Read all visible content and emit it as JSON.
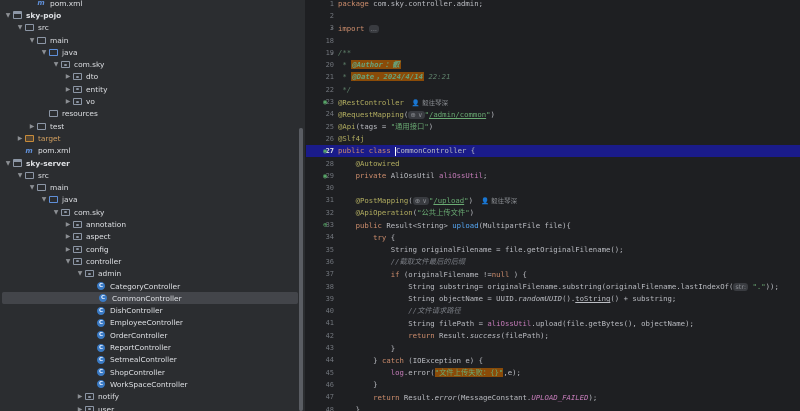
{
  "project_tree": {
    "items": [
      {
        "label": "pom.xml",
        "indent": 2,
        "chevron": "",
        "icon": "maven-icon"
      },
      {
        "label": "sky-pojo",
        "indent": 0,
        "chevron": "v",
        "icon": "module-folder-icon",
        "bold": true
      },
      {
        "label": "src",
        "indent": 1,
        "chevron": "v",
        "icon": "folder-icon"
      },
      {
        "label": "main",
        "indent": 2,
        "chevron": "v",
        "icon": "folder-icon"
      },
      {
        "label": "java",
        "indent": 3,
        "chevron": "v",
        "icon": "source-folder-icon"
      },
      {
        "label": "com.sky",
        "indent": 4,
        "chevron": "v",
        "icon": "package-icon"
      },
      {
        "label": "dto",
        "indent": 5,
        "chevron": ">",
        "icon": "package-icon"
      },
      {
        "label": "entity",
        "indent": 5,
        "chevron": ">",
        "icon": "package-icon"
      },
      {
        "label": "vo",
        "indent": 5,
        "chevron": ">",
        "icon": "package-icon"
      },
      {
        "label": "resources",
        "indent": 3,
        "chevron": "",
        "icon": "resources-folder-icon"
      },
      {
        "label": "test",
        "indent": 2,
        "chevron": ">",
        "icon": "folder-icon"
      },
      {
        "label": "target",
        "indent": 1,
        "chevron": ">",
        "icon": "target-folder-icon",
        "target": true
      },
      {
        "label": "pom.xml",
        "indent": 1,
        "chevron": "",
        "icon": "maven-icon"
      },
      {
        "label": "sky-server",
        "indent": 0,
        "chevron": "v",
        "icon": "module-folder-icon",
        "bold": true
      },
      {
        "label": "src",
        "indent": 1,
        "chevron": "v",
        "icon": "folder-icon"
      },
      {
        "label": "main",
        "indent": 2,
        "chevron": "v",
        "icon": "folder-icon"
      },
      {
        "label": "java",
        "indent": 3,
        "chevron": "v",
        "icon": "source-folder-icon"
      },
      {
        "label": "com.sky",
        "indent": 4,
        "chevron": "v",
        "icon": "package-icon"
      },
      {
        "label": "annotation",
        "indent": 5,
        "chevron": ">",
        "icon": "package-icon"
      },
      {
        "label": "aspect",
        "indent": 5,
        "chevron": ">",
        "icon": "package-icon"
      },
      {
        "label": "config",
        "indent": 5,
        "chevron": ">",
        "icon": "package-icon"
      },
      {
        "label": "controller",
        "indent": 5,
        "chevron": "v",
        "icon": "package-icon"
      },
      {
        "label": "admin",
        "indent": 6,
        "chevron": "v",
        "icon": "package-icon"
      },
      {
        "label": "CategoryController",
        "indent": 7,
        "chevron": "",
        "icon": "class-icon"
      },
      {
        "label": "CommonController",
        "indent": 7,
        "chevron": "",
        "icon": "class-icon",
        "selected": true
      },
      {
        "label": "DishController",
        "indent": 7,
        "chevron": "",
        "icon": "class-icon"
      },
      {
        "label": "EmployeeController",
        "indent": 7,
        "chevron": "",
        "icon": "class-icon"
      },
      {
        "label": "OrderController",
        "indent": 7,
        "chevron": "",
        "icon": "class-icon"
      },
      {
        "label": "ReportController",
        "indent": 7,
        "chevron": "",
        "icon": "class-icon"
      },
      {
        "label": "SetmealController",
        "indent": 7,
        "chevron": "",
        "icon": "class-icon"
      },
      {
        "label": "ShopController",
        "indent": 7,
        "chevron": "",
        "icon": "class-icon"
      },
      {
        "label": "WorkSpaceController",
        "indent": 7,
        "chevron": "",
        "icon": "class-icon"
      },
      {
        "label": "notify",
        "indent": 6,
        "chevron": ">",
        "icon": "package-icon"
      },
      {
        "label": "user",
        "indent": 6,
        "chevron": ">",
        "icon": "package-icon"
      }
    ]
  },
  "editor": {
    "current_line": 27,
    "lines": [
      {
        "n": "1",
        "segs": [
          [
            "kw",
            "package "
          ],
          [
            "",
            "com.sky.controller.admin;"
          ]
        ]
      },
      {
        "n": "2",
        "segs": []
      },
      {
        "n": "3",
        "fold": ">",
        "segs": [
          [
            "kw",
            "import "
          ],
          [
            "hint",
            "..."
          ]
        ]
      },
      {
        "n": "18",
        "segs": []
      },
      {
        "n": "19",
        "fold": "v",
        "segs": [
          [
            "doc",
            "/**"
          ]
        ]
      },
      {
        "n": "20",
        "segs": [
          [
            "doc",
            " * "
          ],
          [
            "doctag",
            "@Author"
          ],
          [
            "doctag",
            "：叡"
          ]
        ]
      },
      {
        "n": "21",
        "segs": [
          [
            "doc",
            " * "
          ],
          [
            "doctag",
            "@Date"
          ],
          [
            "doctag",
            "，2024/4/14"
          ],
          [
            "doc",
            " 22:21"
          ]
        ]
      },
      {
        "n": "22",
        "segs": [
          [
            "doc",
            " */"
          ]
        ]
      },
      {
        "n": "23",
        "gutter": "bean-icon",
        "segs": [
          [
            "ann",
            "@RestController"
          ],
          [
            "author",
            "👤 毅往琴深"
          ]
        ]
      },
      {
        "n": "24",
        "segs": [
          [
            "ann",
            "@RequestMapping"
          ],
          [
            "",
            "("
          ],
          [
            "hint",
            "⊕ ∨"
          ],
          [
            "str",
            "\""
          ],
          [
            "str link",
            "/admin/common"
          ],
          [
            "str",
            "\""
          ],
          [
            "",
            ")"
          ]
        ]
      },
      {
        "n": "25",
        "segs": [
          [
            "ann",
            "@Api"
          ],
          [
            "",
            "(tags = "
          ],
          [
            "str",
            "\"通用接口\""
          ],
          [
            "",
            ")"
          ]
        ]
      },
      {
        "n": "26",
        "segs": [
          [
            "ann",
            "@Slf4j"
          ]
        ]
      },
      {
        "n": "27",
        "gutter": "bean-icon",
        "segs": [
          [
            "kw",
            "public class "
          ],
          [
            "cursor",
            ""
          ],
          [
            "",
            "CommonController {"
          ]
        ]
      },
      {
        "n": "28",
        "segs": [
          [
            "ann",
            "    @Autowired"
          ]
        ]
      },
      {
        "n": "29",
        "gutter": "bean-icon",
        "segs": [
          [
            "kw",
            "    private "
          ],
          [
            "",
            "AliOssUtil "
          ],
          [
            "field",
            "aliOssUtil"
          ],
          [
            "",
            ";"
          ]
        ]
      },
      {
        "n": "30",
        "segs": []
      },
      {
        "n": "31",
        "segs": [
          [
            "ann",
            "    @PostMapping"
          ],
          [
            "",
            "("
          ],
          [
            "hint",
            "⊕ ∨"
          ],
          [
            "str",
            "\""
          ],
          [
            "str link",
            "/upload"
          ],
          [
            "str",
            "\""
          ],
          [
            "",
            ")"
          ],
          [
            "author",
            "👤 毅往琴深"
          ]
        ]
      },
      {
        "n": "32",
        "segs": [
          [
            "ann",
            "    @ApiOperation"
          ],
          [
            "",
            "("
          ],
          [
            "str",
            "\"公共上传文件\""
          ],
          [
            "",
            ")"
          ]
        ]
      },
      {
        "n": "33",
        "gutter": "web-icon",
        "segs": [
          [
            "kw",
            "    public "
          ],
          [
            "",
            "Result<String> "
          ],
          [
            "fn",
            "upload"
          ],
          [
            "",
            "(MultipartFile file){"
          ]
        ]
      },
      {
        "n": "34",
        "segs": [
          [
            "kw",
            "        try "
          ],
          [
            "",
            "{"
          ]
        ]
      },
      {
        "n": "35",
        "segs": [
          [
            "",
            "            String originalFilename = file.getOriginalFilename();"
          ]
        ]
      },
      {
        "n": "36",
        "segs": [
          [
            "cmt",
            "            //截取文件最后的后缀"
          ]
        ]
      },
      {
        "n": "37",
        "segs": [
          [
            "kw",
            "            if "
          ],
          [
            "",
            "(originalFilename !="
          ],
          [
            "kw",
            "null"
          ],
          [
            "",
            " ) {"
          ]
        ]
      },
      {
        "n": "38",
        "segs": [
          [
            "",
            "                String substring= originalFilename.substring(originalFilename.lastIndexOf("
          ],
          [
            "hint",
            "str:"
          ],
          [
            "str",
            " \".\""
          ],
          [
            "",
            "));"
          ]
        ]
      },
      {
        "n": "39",
        "segs": [
          [
            "",
            "                String objectName = UUID."
          ],
          [
            "static",
            "randomUUID"
          ],
          [
            "",
            "()."
          ],
          [
            "link",
            "toString"
          ],
          [
            "",
            "() + substring;"
          ]
        ]
      },
      {
        "n": "40",
        "segs": [
          [
            "cmt",
            "                //文件请求路径"
          ]
        ]
      },
      {
        "n": "41",
        "segs": [
          [
            "",
            "                String filePath = "
          ],
          [
            "field",
            "aliOssUtil"
          ],
          [
            "",
            ".upload(file.getBytes(), objectName);"
          ]
        ]
      },
      {
        "n": "42",
        "segs": [
          [
            "kw",
            "                return "
          ],
          [
            "",
            "Result."
          ],
          [
            "static",
            "success"
          ],
          [
            "",
            "(filePath);"
          ]
        ]
      },
      {
        "n": "43",
        "segs": [
          [
            "",
            "            }"
          ]
        ]
      },
      {
        "n": "44",
        "segs": [
          [
            "",
            "        } "
          ],
          [
            "kw",
            "catch "
          ],
          [
            "",
            "(IOException e) {"
          ]
        ]
      },
      {
        "n": "45",
        "segs": [
          [
            "field",
            "            log"
          ],
          [
            "",
            ".error("
          ],
          [
            "str hl-str",
            "\"文件上传失败：{}\""
          ],
          [
            "",
            ",e);"
          ]
        ]
      },
      {
        "n": "46",
        "segs": [
          [
            "",
            "        }"
          ]
        ]
      },
      {
        "n": "47",
        "segs": [
          [
            "kw",
            "        return "
          ],
          [
            "",
            "Result."
          ],
          [
            "static",
            "error"
          ],
          [
            "",
            "(MessageConstant."
          ],
          [
            "const",
            "UPLOAD_FAILED"
          ],
          [
            "",
            ");"
          ]
        ]
      },
      {
        "n": "48",
        "segs": [
          [
            "",
            "    }"
          ]
        ]
      }
    ]
  }
}
